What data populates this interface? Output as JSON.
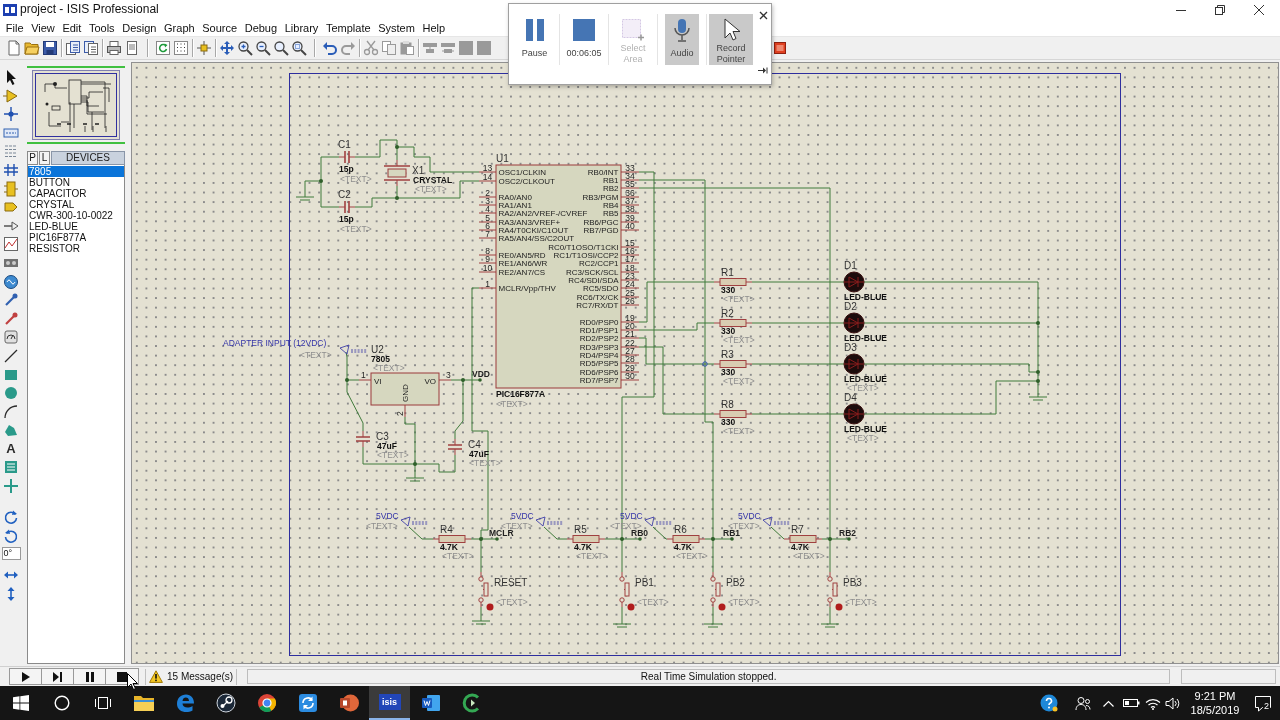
{
  "window": {
    "title": "project - ISIS Professional"
  },
  "menu": [
    "File",
    "View",
    "Edit",
    "Tools",
    "Design",
    "Graph",
    "Source",
    "Debug",
    "Library",
    "Template",
    "System",
    "Help"
  ],
  "recorder": {
    "buttons": [
      {
        "kind": "pause",
        "label": "Pause",
        "selected": false,
        "disabled": false
      },
      {
        "kind": "stop",
        "label": "00:06:05",
        "selected": false,
        "disabled": false
      },
      {
        "kind": "area",
        "label": "Select Area",
        "selected": false,
        "disabled": true
      },
      {
        "kind": "audio",
        "label": "Audio",
        "selected": true,
        "disabled": false
      },
      {
        "kind": "pointer",
        "label": "Record Pointer",
        "selected": true,
        "disabled": false
      }
    ]
  },
  "left_toolbar": {
    "text_tool": "A",
    "rotation": "0°"
  },
  "device_panel": {
    "buttons": [
      "P",
      "L"
    ],
    "title": "DEVICES",
    "items": [
      {
        "label": "7805",
        "selected": true
      },
      {
        "label": "BUTTON",
        "selected": false
      },
      {
        "label": "CAPACITOR",
        "selected": false
      },
      {
        "label": "CRYSTAL",
        "selected": false
      },
      {
        "label": "CWR-300-10-0022",
        "selected": false
      },
      {
        "label": "LED-BLUE",
        "selected": false
      },
      {
        "label": "PIC16F877A",
        "selected": false
      },
      {
        "label": "RESISTOR",
        "selected": false
      }
    ]
  },
  "schematic": {
    "parts": [
      {
        "kind": "capacitor",
        "ref": "C1",
        "value": "15p",
        "text": "<TEXT>"
      },
      {
        "kind": "capacitor",
        "ref": "C2",
        "value": "15p",
        "text": "<TEXT>"
      },
      {
        "kind": "crystal",
        "ref": "X1",
        "value": "CRYSTAL",
        "text": "<TEXT>"
      },
      {
        "kind": "mcu",
        "ref": "U1",
        "value": "PIC16F877A",
        "text": "<TEXT>",
        "pins_left": [
          {
            "number": "13",
            "name": "OSC1/CLKIN"
          },
          {
            "number": "14",
            "name": "OSC2/CLKOUT"
          },
          {
            "number": "2",
            "name": "RA0/AN0"
          },
          {
            "number": "3",
            "name": "RA1/AN1"
          },
          {
            "number": "4",
            "name": "RA2/AN2/VREF-/CVREF"
          },
          {
            "number": "5",
            "name": "RA3/AN3/VREF+"
          },
          {
            "number": "6",
            "name": "RA4/T0CKI/C1OUT"
          },
          {
            "number": "7",
            "name": "RA5/AN4/SS/C2OUT"
          },
          {
            "number": "8",
            "name": "RE0/AN5/RD"
          },
          {
            "number": "9",
            "name": "RE1/AN6/WR"
          },
          {
            "number": "10",
            "name": "RE2/AN7/CS"
          },
          {
            "number": "1",
            "name": "MCLR/Vpp/THV"
          }
        ],
        "pins_right": [
          {
            "number": "33",
            "name": "RB0/INT"
          },
          {
            "number": "34",
            "name": "RB1"
          },
          {
            "number": "35",
            "name": "RB2"
          },
          {
            "number": "36",
            "name": "RB3/PGM"
          },
          {
            "number": "37",
            "name": "RB4"
          },
          {
            "number": "38",
            "name": "RB5"
          },
          {
            "number": "39",
            "name": "RB6/PGC"
          },
          {
            "number": "40",
            "name": "RB7/PGD"
          },
          {
            "number": "15",
            "name": "RC0/T1OSO/T1CKI"
          },
          {
            "number": "16",
            "name": "RC1/T1OSI/CCP2"
          },
          {
            "number": "17",
            "name": "RC2/CCP1"
          },
          {
            "number": "18",
            "name": "RC3/SCK/SCL"
          },
          {
            "number": "23",
            "name": "RC4/SDI/SDA"
          },
          {
            "number": "24",
            "name": "RC5/SDO"
          },
          {
            "number": "25",
            "name": "RC6/TX/CK"
          },
          {
            "number": "26",
            "name": "RC7/RX/DT"
          },
          {
            "number": "19",
            "name": "RD0/PSP0"
          },
          {
            "number": "20",
            "name": "RD1/PSP1"
          },
          {
            "number": "21",
            "name": "RD2/PSP2"
          },
          {
            "number": "22",
            "name": "RD3/PSP3"
          },
          {
            "number": "27",
            "name": "RD4/PSP4"
          },
          {
            "number": "28",
            "name": "RD5/PSP5"
          },
          {
            "number": "29",
            "name": "RD6/PSP6"
          },
          {
            "number": "30",
            "name": "RD7/PSP7"
          }
        ]
      },
      {
        "kind": "regulator",
        "ref": "U2",
        "value": "7805",
        "text": "<TEXT>",
        "pins": [
          {
            "number": "1",
            "name": "VI"
          },
          {
            "number": "3",
            "name": "VO"
          },
          {
            "number": "2",
            "name": "GND"
          }
        ]
      },
      {
        "kind": "capacitor_v",
        "ref": "C3",
        "value": "47uF",
        "text": "<TEXT>"
      },
      {
        "kind": "capacitor_v",
        "ref": "C4",
        "value": "47uF",
        "text": "<TEXT>"
      },
      {
        "kind": "resistor",
        "ref": "R1",
        "value": "330",
        "text": "<TEXT>"
      },
      {
        "kind": "resistor",
        "ref": "R2",
        "value": "330",
        "text": "<TEXT>"
      },
      {
        "kind": "resistor",
        "ref": "R3",
        "value": "330",
        "text": "<TEXT>"
      },
      {
        "kind": "resistor",
        "ref": "R8",
        "value": "330",
        "text": "<TEXT>"
      },
      {
        "kind": "led",
        "ref": "D1",
        "value": "LED-BLUE",
        "lit": false
      },
      {
        "kind": "led",
        "ref": "D2",
        "value": "LED-BLUE",
        "lit": false
      },
      {
        "kind": "led",
        "ref": "D3",
        "value": "LED-BLUE",
        "text": "<TEXT>",
        "lit": false
      },
      {
        "kind": "led",
        "ref": "D4",
        "value": "LED-BLUE",
        "text": "<TEXT>",
        "lit": false
      },
      {
        "kind": "resistor",
        "ref": "R4",
        "value": "4.7K",
        "text": "<TEXT>"
      },
      {
        "kind": "resistor",
        "ref": "R5",
        "value": "4.7K",
        "text": "<TEXT>"
      },
      {
        "kind": "resistor",
        "ref": "R6",
        "value": "4.7K",
        "text": "<TEXT>"
      },
      {
        "kind": "resistor",
        "ref": "R7",
        "value": "4.7K",
        "text": "<TEXT>"
      },
      {
        "kind": "button",
        "ref": "RESET",
        "text": "<TEXT>"
      },
      {
        "kind": "button",
        "ref": "PB1",
        "text": "<TEXT>"
      },
      {
        "kind": "button",
        "ref": "PB2",
        "text": "<TEXT>"
      },
      {
        "kind": "button",
        "ref": "PB3",
        "text": "<TEXT>"
      }
    ],
    "terminals": [
      {
        "label": "ADAPTER INPUT (12VDC)",
        "text": "<TEXT>"
      },
      {
        "label": "5VDC",
        "text": "<TEXT>"
      },
      {
        "label": "5VDC",
        "text": "<TEXT>"
      },
      {
        "label": "5VDC",
        "text": "<TEXT>"
      },
      {
        "label": "5VDC",
        "text": "<TEXT>"
      }
    ],
    "net_labels": [
      "VDD",
      "MCLR",
      "RB0",
      "RB1",
      "RB2"
    ]
  },
  "status_bar": {
    "messages": "15 Message(s)",
    "status": "Real Time Simulation stopped."
  },
  "taskbar": {
    "apps": [
      {
        "kind": "files",
        "active": false
      },
      {
        "kind": "edge",
        "active": false
      },
      {
        "kind": "steam",
        "active": false
      },
      {
        "kind": "chrome",
        "active": false
      },
      {
        "kind": "sync",
        "active": false
      },
      {
        "kind": "slides",
        "active": false
      },
      {
        "kind": "isis",
        "label": "isis",
        "active": true
      },
      {
        "kind": "word",
        "active": false
      },
      {
        "kind": "cad",
        "active": false
      }
    ],
    "clock": {
      "time": "9:21 PM",
      "date": "18/5/2019"
    },
    "notifications": "2"
  }
}
